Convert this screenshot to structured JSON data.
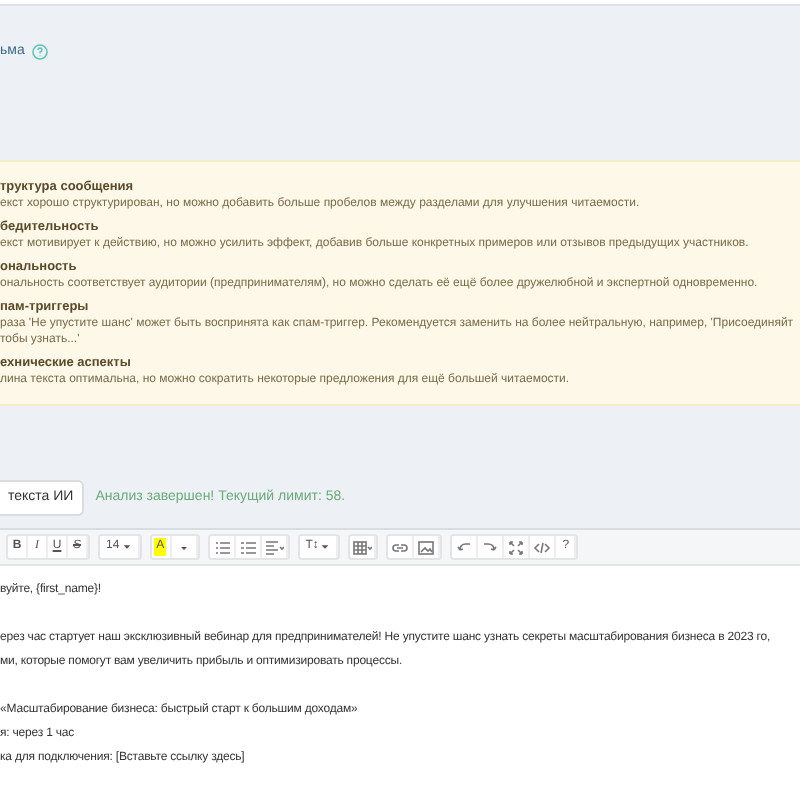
{
  "field_label": {
    "text": "ьма"
  },
  "analysis": [
    {
      "heading": "труктура сообщения",
      "text": "екст хорошо структурирован, но можно добавить больше пробелов между разделами для улучшения читаемости."
    },
    {
      "heading": "бедительность",
      "text": "екст мотивирует к действию, но можно усилить эффект, добавив больше конкретных примеров или отзывов предыдущих участников."
    },
    {
      "heading": "ональность",
      "text": "ональность соответствует аудитории (предпринимателям), но можно сделать её ещё более дружелюбной и экспертной одновременно."
    },
    {
      "heading": "пам-триггеры",
      "text": "раза 'Не упустите шанс' может быть воспринята как спам-триггер. Рекомендуется заменить на более нейтральную, например, 'Присоединяйт",
      "text_2": "тобы узнать...'"
    },
    {
      "heading": "ехнические аспекты",
      "text": "лина текста оптимальна, но можно сократить некоторые предложения для ещё большей читаемости."
    }
  ],
  "ai_button": {
    "label": "текста ИИ"
  },
  "status": {
    "text": "Анализ завершен! Текущий лимит: 58."
  },
  "toolbar": [
    [
      {
        "kind": "bold",
        "label": "B"
      },
      {
        "kind": "italic",
        "label": "I"
      },
      {
        "kind": "underline",
        "label": "U"
      },
      {
        "kind": "strike",
        "label": "S"
      }
    ],
    [
      {
        "kind": "font_size",
        "label": "14"
      }
    ],
    [
      {
        "kind": "highlight",
        "label": "A"
      },
      {
        "kind": "dropdown"
      }
    ],
    [
      {
        "kind": "ul"
      },
      {
        "kind": "ol"
      },
      {
        "kind": "align"
      }
    ],
    [
      {
        "kind": "text_style",
        "label": "T↕"
      }
    ],
    [
      {
        "kind": "table"
      }
    ],
    [
      {
        "kind": "link"
      },
      {
        "kind": "image"
      }
    ],
    [
      {
        "kind": "undo"
      },
      {
        "kind": "redo"
      },
      {
        "kind": "fullscreen"
      },
      {
        "kind": "code"
      },
      {
        "kind": "help",
        "label": "?"
      }
    ]
  ],
  "editor_paragraphs": [
    [
      "вуйте, {first_name}!"
    ],
    [
      "ерез час стартует наш эксклюзивный вебинар для предпринимателей! Не упустите шанс узнать секреты масштабирования бизнеса в 2023 го,",
      "ми, которые помогут вам увеличить прибыль и оптимизировать процессы."
    ],
    [
      "«Масштабирование бизнеса: быстрый старт к большим доходам»",
      "я: через 1 час",
      "ка для подключения: [Вставьте ссылку здесь]"
    ]
  ]
}
